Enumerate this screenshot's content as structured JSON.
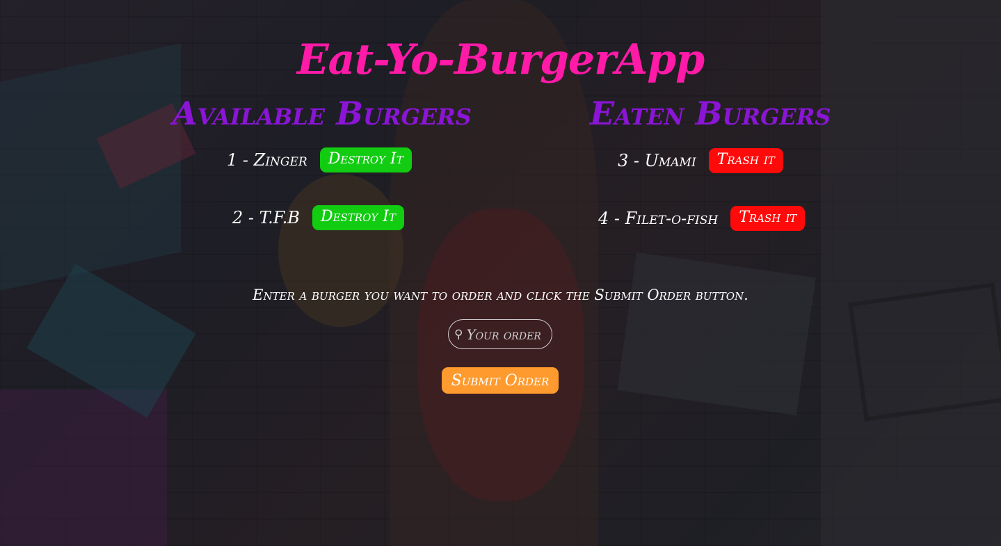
{
  "app": {
    "title": "Eat-Yo-BurgerApp"
  },
  "available": {
    "heading": "Available Burgers",
    "items": [
      {
        "label": "1 - Zinger",
        "button": "Destroy It"
      },
      {
        "label": "2 - T.F.B",
        "button": "Destroy It"
      }
    ]
  },
  "eaten": {
    "heading": "Eaten Burgers",
    "items": [
      {
        "label": "3 - Umami",
        "button": "Trash it"
      },
      {
        "label": "4 - Filet-o-fish",
        "button": "Trash it"
      }
    ]
  },
  "order": {
    "instructions": "Enter a burger you want to order and click the Submit Order button.",
    "placeholder": "Your order",
    "search_icon": "search-icon",
    "submit_label": "Submit Order"
  },
  "colors": {
    "title": "#ff1aa8",
    "headings": "#8b15d6",
    "destroy_button": "#11cc11",
    "trash_button": "#ff0a0a",
    "submit_button": "#ff9a2e"
  }
}
